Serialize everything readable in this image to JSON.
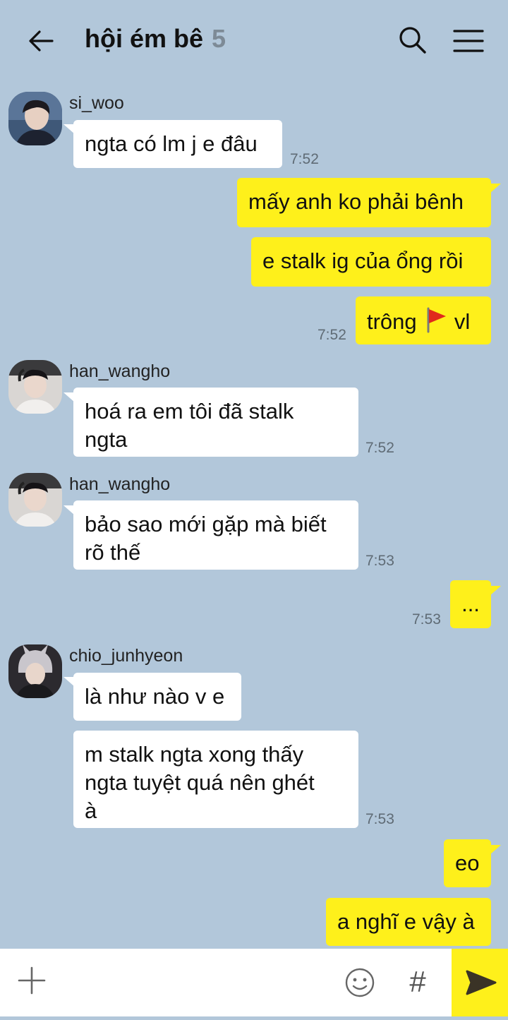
{
  "header": {
    "title": "hội ém bê",
    "member_count": "5",
    "back_icon": "arrow-left-icon",
    "search_icon": "search-icon",
    "menu_icon": "hamburger-menu-icon"
  },
  "messages": [
    {
      "sender": "si_woo",
      "lines": [
        "ngta có lm j e đâu"
      ],
      "time": "7:52",
      "direction": "in"
    },
    {
      "lines": [
        "mấy anh ko phải bênh"
      ],
      "direction": "out"
    },
    {
      "lines": [
        "e stalk ig của ổng rồi"
      ],
      "direction": "out"
    },
    {
      "lines_prefix": "trông",
      "emoji": "red-flag-emoji",
      "lines_suffix": "vl",
      "time": "7:52",
      "direction": "out"
    },
    {
      "sender": "han_wangho",
      "lines": [
        "hoá ra em tôi đã stalk",
        "ngta"
      ],
      "time": "7:52",
      "direction": "in"
    },
    {
      "sender": "han_wangho",
      "lines": [
        "bảo sao mới gặp mà biết",
        "rõ thế"
      ],
      "time": "7:53",
      "direction": "in"
    },
    {
      "lines": [
        "..."
      ],
      "time": "7:53",
      "direction": "out"
    },
    {
      "sender": "chio_junhyeon",
      "lines": [
        "là như nào v e"
      ],
      "direction": "in"
    },
    {
      "lines": [
        "m stalk ngta xong thấy",
        "ngta tuyệt quá nên ghét",
        "à"
      ],
      "time": "7:53",
      "direction": "in"
    },
    {
      "lines": [
        "eo"
      ],
      "direction": "out"
    },
    {
      "lines": [
        "a nghĩ e vậy à"
      ],
      "direction": "out"
    }
  ],
  "input_bar": {
    "plus_icon": "plus-icon",
    "emoji_icon": "smiley-icon",
    "hashtag_label": "#",
    "send_icon": "send-arrow-icon"
  },
  "colors": {
    "background": "#b2c7da",
    "outgoing_bubble": "#fef01b",
    "incoming_bubble": "#ffffff",
    "send_button": "#fef01b"
  }
}
